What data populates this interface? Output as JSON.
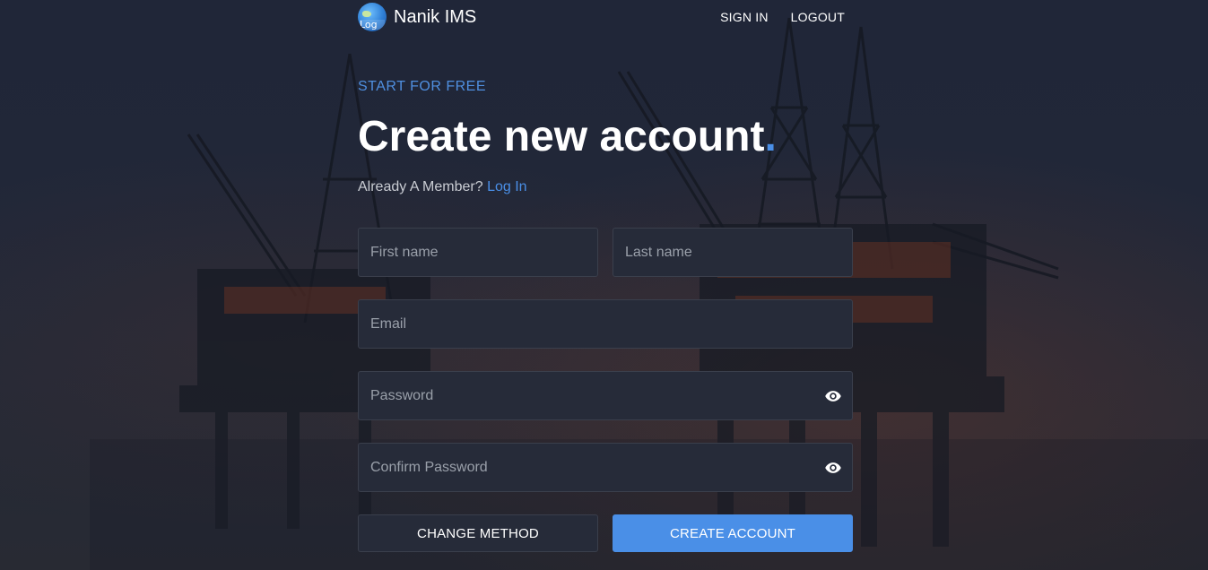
{
  "brand": {
    "name": "Nanik IMS",
    "logo_text": "Log"
  },
  "nav": {
    "sign_in": "SIGN IN",
    "logout": "LOGOUT"
  },
  "form": {
    "eyebrow": "START FOR FREE",
    "title": "Create new account",
    "title_dot": ".",
    "member_text": "Already A Member?",
    "login_link": "Log In",
    "fields": {
      "first_name": {
        "placeholder": "First name",
        "value": ""
      },
      "last_name": {
        "placeholder": "Last name",
        "value": ""
      },
      "email": {
        "placeholder": "Email",
        "value": ""
      },
      "password": {
        "placeholder": "Password",
        "value": ""
      },
      "confirm_password": {
        "placeholder": "Confirm Password",
        "value": ""
      }
    },
    "buttons": {
      "change_method": "CHANGE METHOD",
      "create_account": "CREATE ACCOUNT"
    }
  },
  "colors": {
    "accent": "#4a8fe7",
    "background": "#1f2431",
    "field_bg": "#262b39",
    "field_border": "#3a3f4c"
  },
  "icons": {
    "password_toggle": "eye-icon",
    "confirm_password_toggle": "eye-icon"
  }
}
